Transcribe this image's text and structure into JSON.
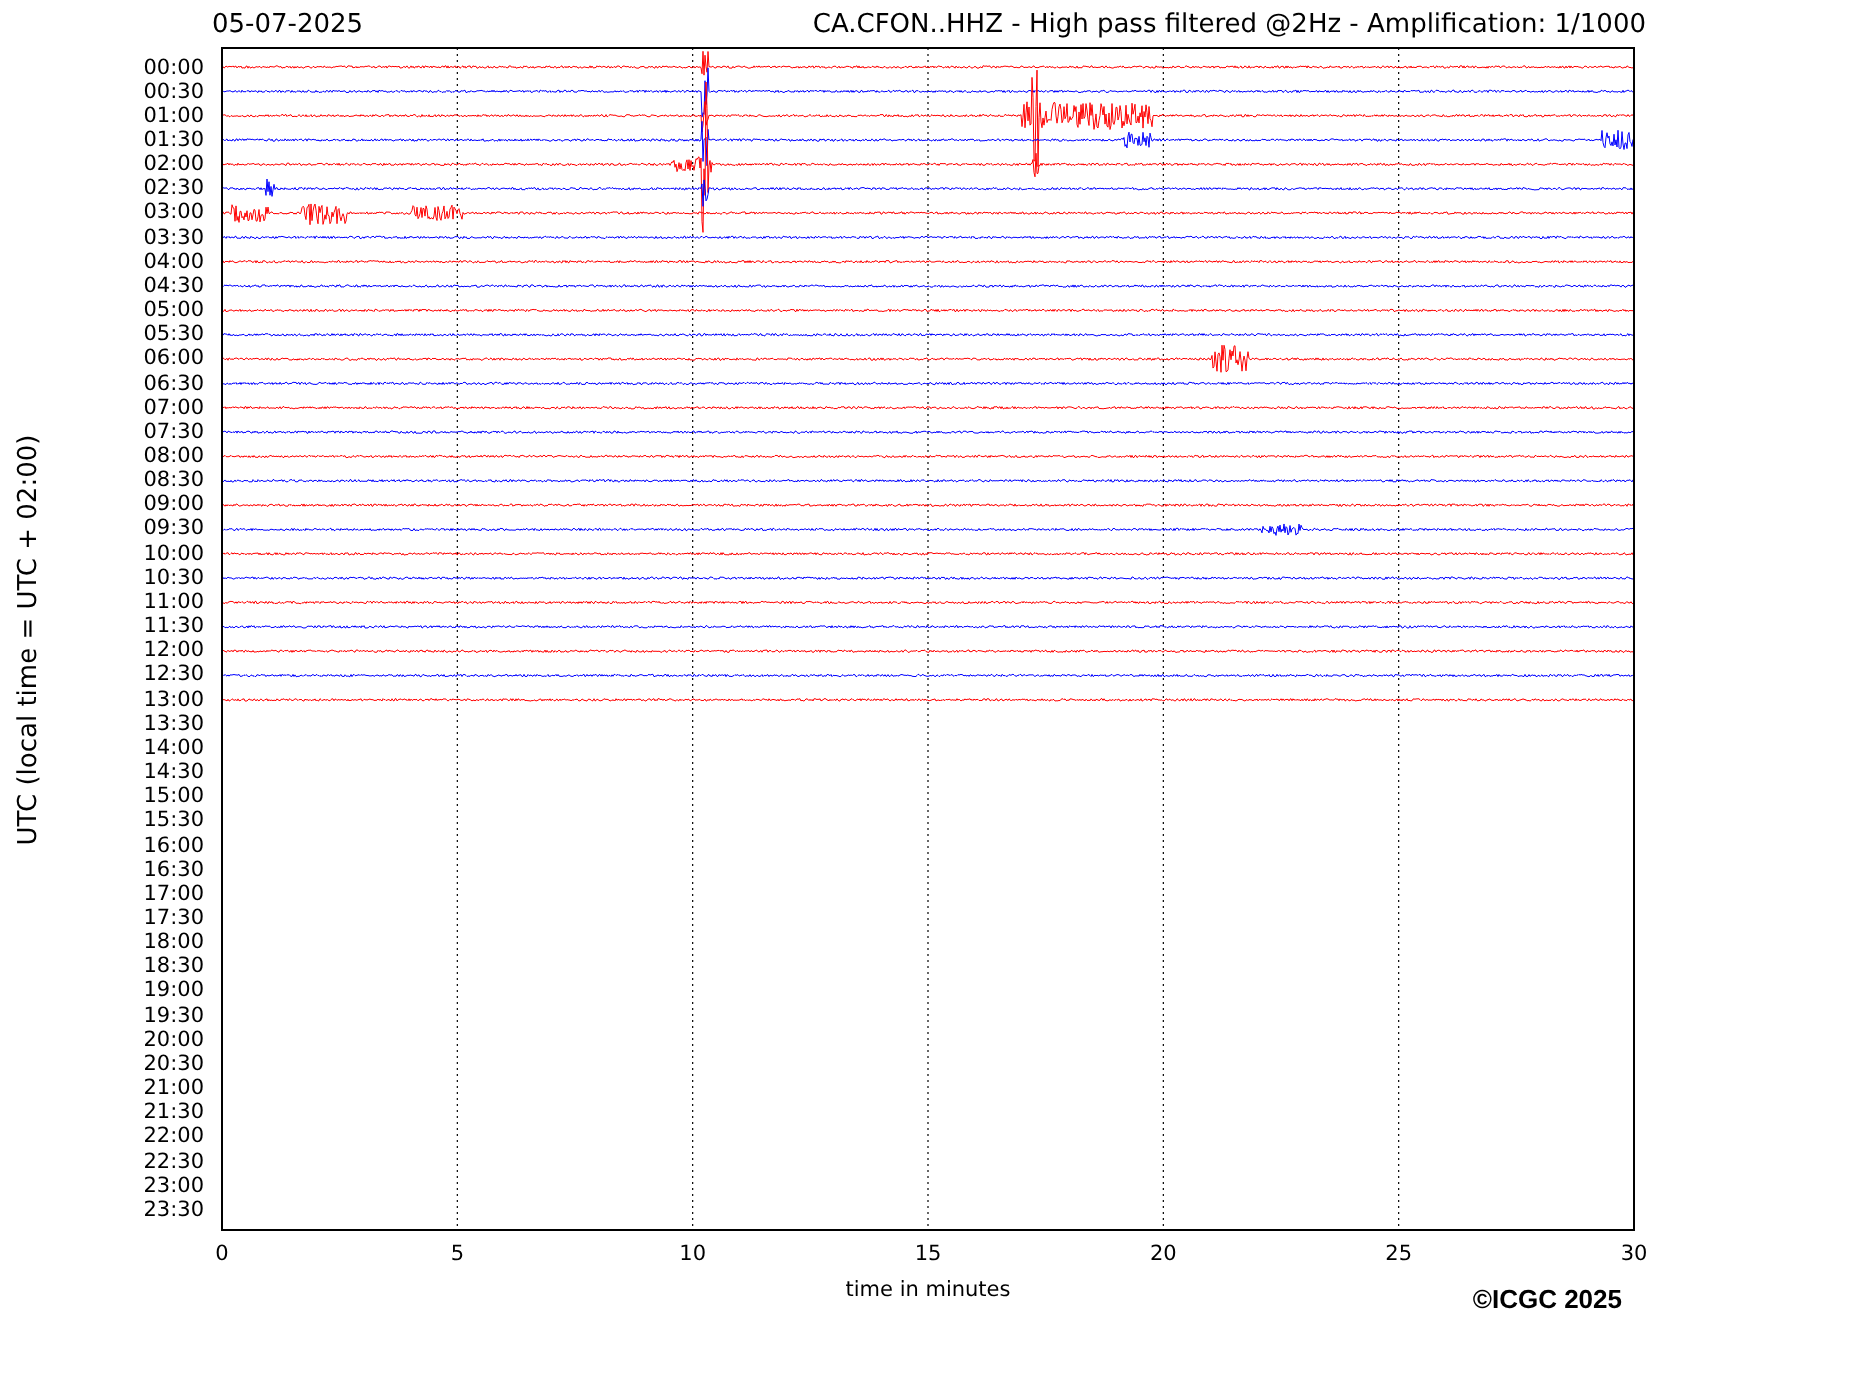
{
  "header": {
    "date": "05-07-2025",
    "title": "CA.CFON..HHZ - High pass filtered @2Hz - Amplification: 1/1000"
  },
  "plot": {
    "ylabel": "UTC (local time = UTC + 02:00)",
    "xlabel": "time in minutes",
    "xticks": [
      "0",
      "5",
      "10",
      "15",
      "20",
      "25",
      "30"
    ],
    "rows": [
      {
        "label": "00:00",
        "color": "#ff0000"
      },
      {
        "label": "00:30",
        "color": "#0000ff"
      },
      {
        "label": "01:00",
        "color": "#ff0000"
      },
      {
        "label": "01:30",
        "color": "#0000ff"
      },
      {
        "label": "02:00",
        "color": "#ff0000"
      },
      {
        "label": "02:30",
        "color": "#0000ff"
      },
      {
        "label": "03:00",
        "color": "#ff0000"
      },
      {
        "label": "03:30",
        "color": "#0000ff"
      },
      {
        "label": "04:00",
        "color": "#ff0000"
      },
      {
        "label": "04:30",
        "color": "#0000ff"
      },
      {
        "label": "05:00",
        "color": "#ff0000"
      },
      {
        "label": "05:30",
        "color": "#0000ff"
      },
      {
        "label": "06:00",
        "color": "#ff0000"
      },
      {
        "label": "06:30",
        "color": "#0000ff"
      },
      {
        "label": "07:00",
        "color": "#ff0000"
      },
      {
        "label": "07:30",
        "color": "#0000ff"
      },
      {
        "label": "08:00",
        "color": "#ff0000"
      },
      {
        "label": "08:30",
        "color": "#0000ff"
      },
      {
        "label": "09:00",
        "color": "#ff0000"
      },
      {
        "label": "09:30",
        "color": "#0000ff"
      },
      {
        "label": "10:00",
        "color": "#ff0000"
      },
      {
        "label": "10:30",
        "color": "#0000ff"
      },
      {
        "label": "11:00",
        "color": "#ff0000"
      },
      {
        "label": "11:30",
        "color": "#0000ff"
      },
      {
        "label": "12:00",
        "color": "#ff0000"
      },
      {
        "label": "12:30",
        "color": "#0000ff"
      },
      {
        "label": "13:00",
        "color": "#ff0000"
      },
      {
        "label": "13:30"
      },
      {
        "label": "14:00"
      },
      {
        "label": "14:30"
      },
      {
        "label": "15:00"
      },
      {
        "label": "15:30"
      },
      {
        "label": "16:00"
      },
      {
        "label": "16:30"
      },
      {
        "label": "17:00"
      },
      {
        "label": "17:30"
      },
      {
        "label": "18:00"
      },
      {
        "label": "18:30"
      },
      {
        "label": "19:00"
      },
      {
        "label": "19:30"
      },
      {
        "label": "20:00"
      },
      {
        "label": "20:30"
      },
      {
        "label": "21:00"
      },
      {
        "label": "21:30"
      },
      {
        "label": "22:00"
      },
      {
        "label": "22:30"
      },
      {
        "label": "23:00"
      },
      {
        "label": "23:30"
      }
    ]
  },
  "footer": {
    "copyright": "©ICGC 2025"
  }
}
